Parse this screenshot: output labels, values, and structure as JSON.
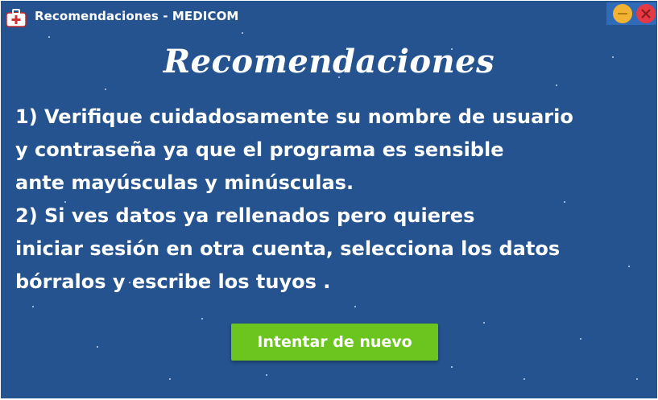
{
  "window": {
    "title": "Recomendaciones - MEDICOM",
    "icon": "medical-kit-icon",
    "controls": {
      "minimize_icon": "minimize-icon",
      "close_icon": "close-icon"
    }
  },
  "content": {
    "heading": "Recomendaciones",
    "lines": [
      "1) Verifique cuidadosamente su nombre de usuario",
      "y contraseña ya que el programa es sensible",
      "ante mayúsculas y minúsculas.",
      "2) Si ves datos ya rellenados pero quieres",
      "iniciar sesión en otra cuenta, selecciona los datos",
      "bórralos y escribe los tuyos ."
    ]
  },
  "actions": {
    "retry_label": "Intentar de nuevo"
  },
  "colors": {
    "background": "#24538f",
    "button": "#6cc51f",
    "minimize": "#f2b233",
    "close": "#e63946",
    "controls_bg": "#2f6bb8"
  }
}
